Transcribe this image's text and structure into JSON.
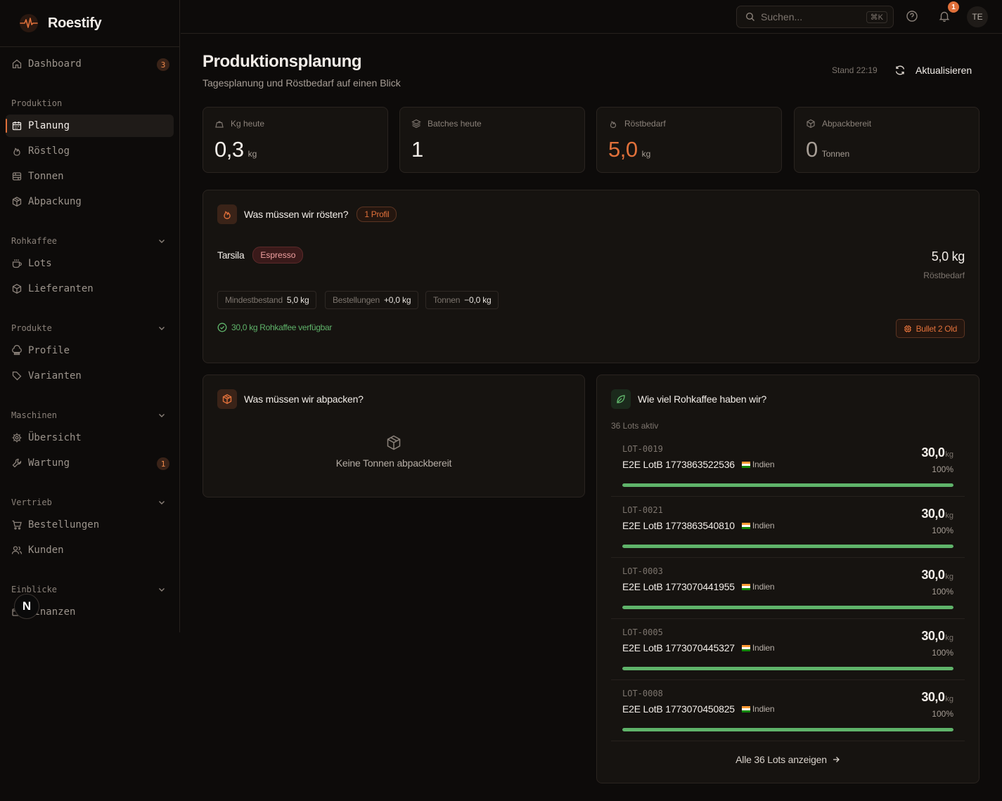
{
  "app": {
    "name": "Roestify"
  },
  "sidebar": {
    "dashboard": {
      "label": "Dashboard",
      "badge": "3"
    },
    "sections": {
      "produktion": "Produktion",
      "rohkaffee": "Rohkaffee",
      "produkte": "Produkte",
      "maschinen": "Maschinen",
      "vertrieb": "Vertrieb",
      "einblicke": "Einblicke"
    },
    "items": {
      "planung": "Planung",
      "roestlog": "Röstlog",
      "tonnen": "Tonnen",
      "abpackung": "Abpackung",
      "lots": "Lots",
      "lieferanten": "Lieferanten",
      "profile": "Profile",
      "varianten": "Varianten",
      "uebersicht": "Übersicht",
      "wartung": "Wartung",
      "wartung_badge": "1",
      "bestellungen": "Bestellungen",
      "kunden": "Kunden",
      "finanzen": "Finanzen"
    },
    "nextjs_badge": "N"
  },
  "topbar": {
    "search_placeholder": "Suchen...",
    "shortcut": "⌘K",
    "notification_count": "1",
    "avatar_initials": "TE"
  },
  "page": {
    "title": "Produktionsplanung",
    "subtitle": "Tagesplanung und Röstbedarf auf einen Blick",
    "stand": "Stand 22:19",
    "refresh_label": "Aktualisieren"
  },
  "kpis": [
    {
      "label": "Kg heute",
      "value": "0,3",
      "unit": "kg"
    },
    {
      "label": "Batches heute",
      "value": "1",
      "unit": ""
    },
    {
      "label": "Röstbedarf",
      "value": "5,0",
      "unit": "kg"
    },
    {
      "label": "Abpackbereit",
      "value": "0",
      "unit": "Tonnen"
    }
  ],
  "roast": {
    "title": "Was müssen wir rösten?",
    "profile_count": "1 Profil",
    "profile_name": "Tarsila",
    "variant_tag": "Espresso",
    "amount": "5,0 kg",
    "amount_label": "Röstbedarf",
    "chips": [
      {
        "label": "Mindestbestand",
        "value": "5,0 kg"
      },
      {
        "label": "Bestellungen",
        "value": "+0,0 kg"
      },
      {
        "label": "Tonnen",
        "value": "−0,0 kg"
      }
    ],
    "available": "30,0 kg Rohkaffee verfügbar",
    "machine": "Bullet 2 Old"
  },
  "pack": {
    "title": "Was müssen wir abpacken?",
    "empty": "Keine Tonnen abpackbereit"
  },
  "green": {
    "title": "Wie viel Rohkaffee haben wir?",
    "active_lots": "36 Lots aktiv",
    "lots": [
      {
        "code": "LOT-0019",
        "name": "E2E LotB 1773863522536",
        "origin": "Indien",
        "kg": "30,0",
        "unit": "kg",
        "pct": "100%",
        "fill": 1.0
      },
      {
        "code": "LOT-0021",
        "name": "E2E LotB 1773863540810",
        "origin": "Indien",
        "kg": "30,0",
        "unit": "kg",
        "pct": "100%",
        "fill": 1.0
      },
      {
        "code": "LOT-0003",
        "name": "E2E LotB 1773070441955",
        "origin": "Indien",
        "kg": "30,0",
        "unit": "kg",
        "pct": "100%",
        "fill": 1.0
      },
      {
        "code": "LOT-0005",
        "name": "E2E LotB 1773070445327",
        "origin": "Indien",
        "kg": "30,0",
        "unit": "kg",
        "pct": "100%",
        "fill": 1.0
      },
      {
        "code": "LOT-0008",
        "name": "E2E LotB 1773070450825",
        "origin": "Indien",
        "kg": "30,0",
        "unit": "kg",
        "pct": "100%",
        "fill": 1.0
      }
    ],
    "show_all": "Alle 36 Lots anzeigen"
  },
  "colors": {
    "accent": "#e0703a",
    "success": "#5fb36a",
    "background": "#0d0b0a",
    "card": "#161310"
  }
}
